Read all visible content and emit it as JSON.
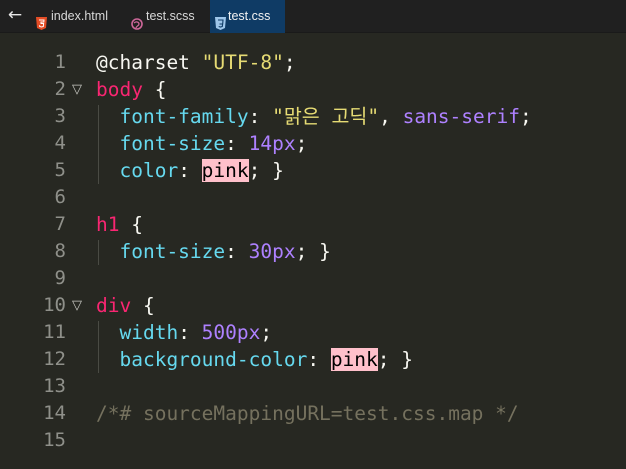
{
  "tabs": [
    {
      "label": "index.html",
      "icon": "html5-file-icon",
      "active": false
    },
    {
      "label": "test.scss",
      "icon": "sass-file-icon",
      "active": false
    },
    {
      "label": "test.css",
      "icon": "css3-file-icon",
      "active": true
    }
  ],
  "back_label": "←",
  "colors": {
    "background": "#272822",
    "tab_active": "#0f3b65",
    "selector": "#f92672",
    "property": "#66d9ef",
    "string": "#e6db74",
    "number": "#ae81ff",
    "comment": "#75715e",
    "swatch_pink": "#ffc0cb"
  },
  "code": {
    "line_numbers": [
      "1",
      "2",
      "3",
      "4",
      "5",
      "6",
      "7",
      "8",
      "9",
      "10",
      "11",
      "12",
      "13",
      "14",
      "15"
    ],
    "fold_marker": "▽",
    "l1": {
      "at": "@charset",
      "str": "\"UTF-8\"",
      "semi": ";"
    },
    "l2": {
      "sel": "body",
      "brace": " {"
    },
    "l3": {
      "prop": "font-family",
      "colon": ": ",
      "str": "\"맑은 고딕\"",
      "comma": ", ",
      "kw": "sans-serif",
      "semi": ";"
    },
    "l4": {
      "prop": "font-size",
      "colon": ": ",
      "num": "14px",
      "semi": ";"
    },
    "l5": {
      "prop": "color",
      "colon": ": ",
      "val": "pink",
      "tail": "; }"
    },
    "l7": {
      "sel": "h1",
      "brace": " {"
    },
    "l8": {
      "prop": "font-size",
      "colon": ": ",
      "num": "30px",
      "tail": "; }"
    },
    "l10": {
      "sel": "div",
      "brace": " {"
    },
    "l11": {
      "prop": "width",
      "colon": ": ",
      "num": "500px",
      "semi": ";"
    },
    "l12": {
      "prop": "background-color",
      "colon": ": ",
      "val": "pink",
      "tail": "; }"
    },
    "l14": {
      "comment": "/*# sourceMappingURL=test.css.map */"
    }
  }
}
